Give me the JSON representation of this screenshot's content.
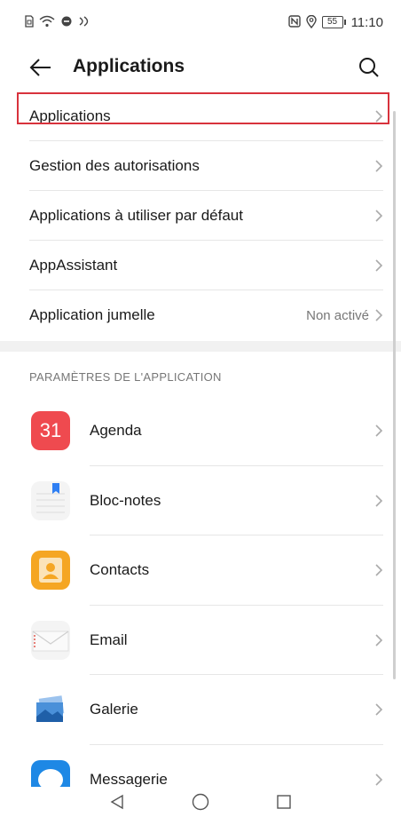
{
  "status_bar": {
    "time": "11:10",
    "battery": "55"
  },
  "header": {
    "title": "Applications"
  },
  "top_list": [
    {
      "label": "Applications",
      "value": ""
    },
    {
      "label": "Gestion des autorisations",
      "value": ""
    },
    {
      "label": "Applications à utiliser par défaut",
      "value": ""
    },
    {
      "label": "AppAssistant",
      "value": ""
    },
    {
      "label": "Application jumelle",
      "value": "Non activé"
    }
  ],
  "section": {
    "title": "PARAMÈTRES DE L'APPLICATION"
  },
  "apps": [
    {
      "label": "Agenda",
      "icon": "calendar-icon",
      "badge": "31"
    },
    {
      "label": "Bloc-notes",
      "icon": "notepad-icon"
    },
    {
      "label": "Contacts",
      "icon": "contacts-icon"
    },
    {
      "label": "Email",
      "icon": "email-icon"
    },
    {
      "label": "Galerie",
      "icon": "gallery-icon"
    },
    {
      "label": "Messagerie",
      "icon": "messaging-icon"
    }
  ],
  "colors": {
    "highlight": "#d8323c",
    "agenda": "#ef4a4f",
    "contacts": "#f5a623",
    "messages": "#1e88e5"
  }
}
